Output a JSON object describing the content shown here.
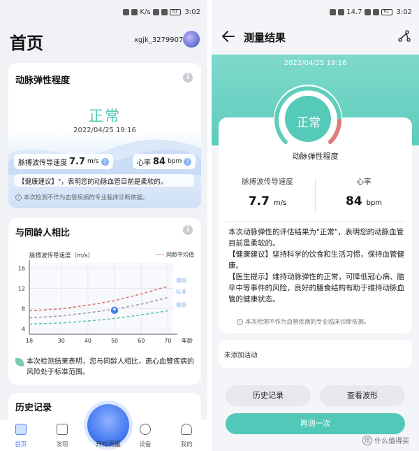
{
  "left": {
    "status": {
      "time": "3:02",
      "battery": "61",
      "speed": "K/s"
    },
    "header": {
      "title": "首页",
      "username": "xgjk_3279907"
    },
    "elasticity_card": {
      "title": "动脉弹性程度",
      "status": "正常",
      "date": "2022/04/25 19:16",
      "pwv_label": "脉搏波传导速度",
      "pwv_value": "7.7",
      "pwv_unit": "m/s",
      "hr_label": "心率",
      "hr_value": "84",
      "hr_unit": "bpm",
      "advice": "【健康建议】\"，表明您的动脉血管目前是柔软的。",
      "note": "本次检测不作为血管疾病的专业临床诊断依据。"
    },
    "compare_card": {
      "title": "与同龄人相比",
      "conclusion": "本次检测结果表明，您与同龄人相比，患心血管疾病的风险处于标准范围。"
    },
    "history_card": {
      "title": "历史记录"
    },
    "fab_label": "开始测量",
    "tabs": [
      {
        "label": "首页"
      },
      {
        "label": "发现"
      },
      {
        "label": ""
      },
      {
        "label": "设备"
      },
      {
        "label": "我的"
      }
    ]
  },
  "chart_data": {
    "type": "line",
    "title": "",
    "ylabel": "脉搏波传导速度（m/s）",
    "xlabel": "年龄",
    "x": [
      18,
      30,
      40,
      50,
      60,
      70
    ],
    "xlim": [
      18,
      72
    ],
    "ylim": [
      3,
      17
    ],
    "yticks": [
      4,
      8,
      12,
      16
    ],
    "legend": {
      "label": "同龄平均值",
      "placement": "top-right"
    },
    "grid": true,
    "series": [
      {
        "name": "偏高",
        "color": "#e07272",
        "values": [
          7.6,
          8.0,
          8.7,
          9.6,
          10.9,
          12.4
        ]
      },
      {
        "name": "标准",
        "color": "#9aa0a8",
        "values": [
          6.2,
          6.6,
          7.2,
          7.9,
          8.9,
          10.2
        ]
      },
      {
        "name": "偏低",
        "color": "#5cc9a8",
        "values": [
          5.0,
          5.2,
          5.6,
          6.1,
          6.8,
          7.6
        ]
      }
    ],
    "user_point": {
      "x": 50,
      "y": 7.7
    }
  },
  "right": {
    "status": {
      "time": "3:02",
      "battery": "61",
      "speed": "14.7"
    },
    "header": {
      "title": "测量结果"
    },
    "date": "2022/04/25 19:16",
    "gauge": {
      "status": "正常",
      "label": "动脉弹性程度"
    },
    "pwv": {
      "label": "脉搏波传导速度",
      "value": "7.7",
      "unit": "m/s"
    },
    "hr": {
      "label": "心率",
      "value": "84",
      "unit": "bpm"
    },
    "result_paragraphs": [
      "本次动脉弹性的评估结果为\"正常\"，表明您的动脉血管目前是柔软的。",
      "【健康建议】坚持科学的饮食和生活习惯，保持血管健康。",
      "【医生提示】维持动脉弹性的正常，可降低冠心病、脑卒中等事件的风险，良好的膳食结构有助于维持动脉血管的健康状态。"
    ],
    "note": "本次检测不作为血管疾病的专业临床诊断依据。",
    "activity": "未添加活动",
    "buttons": {
      "history": "历史记录",
      "waveform": "查看波形",
      "remeasure": "再测一次"
    },
    "watermark": "什么值得买"
  },
  "colors": {
    "teal": "#52c9b8",
    "blue": "#4b7ff0",
    "red": "#e07272"
  }
}
